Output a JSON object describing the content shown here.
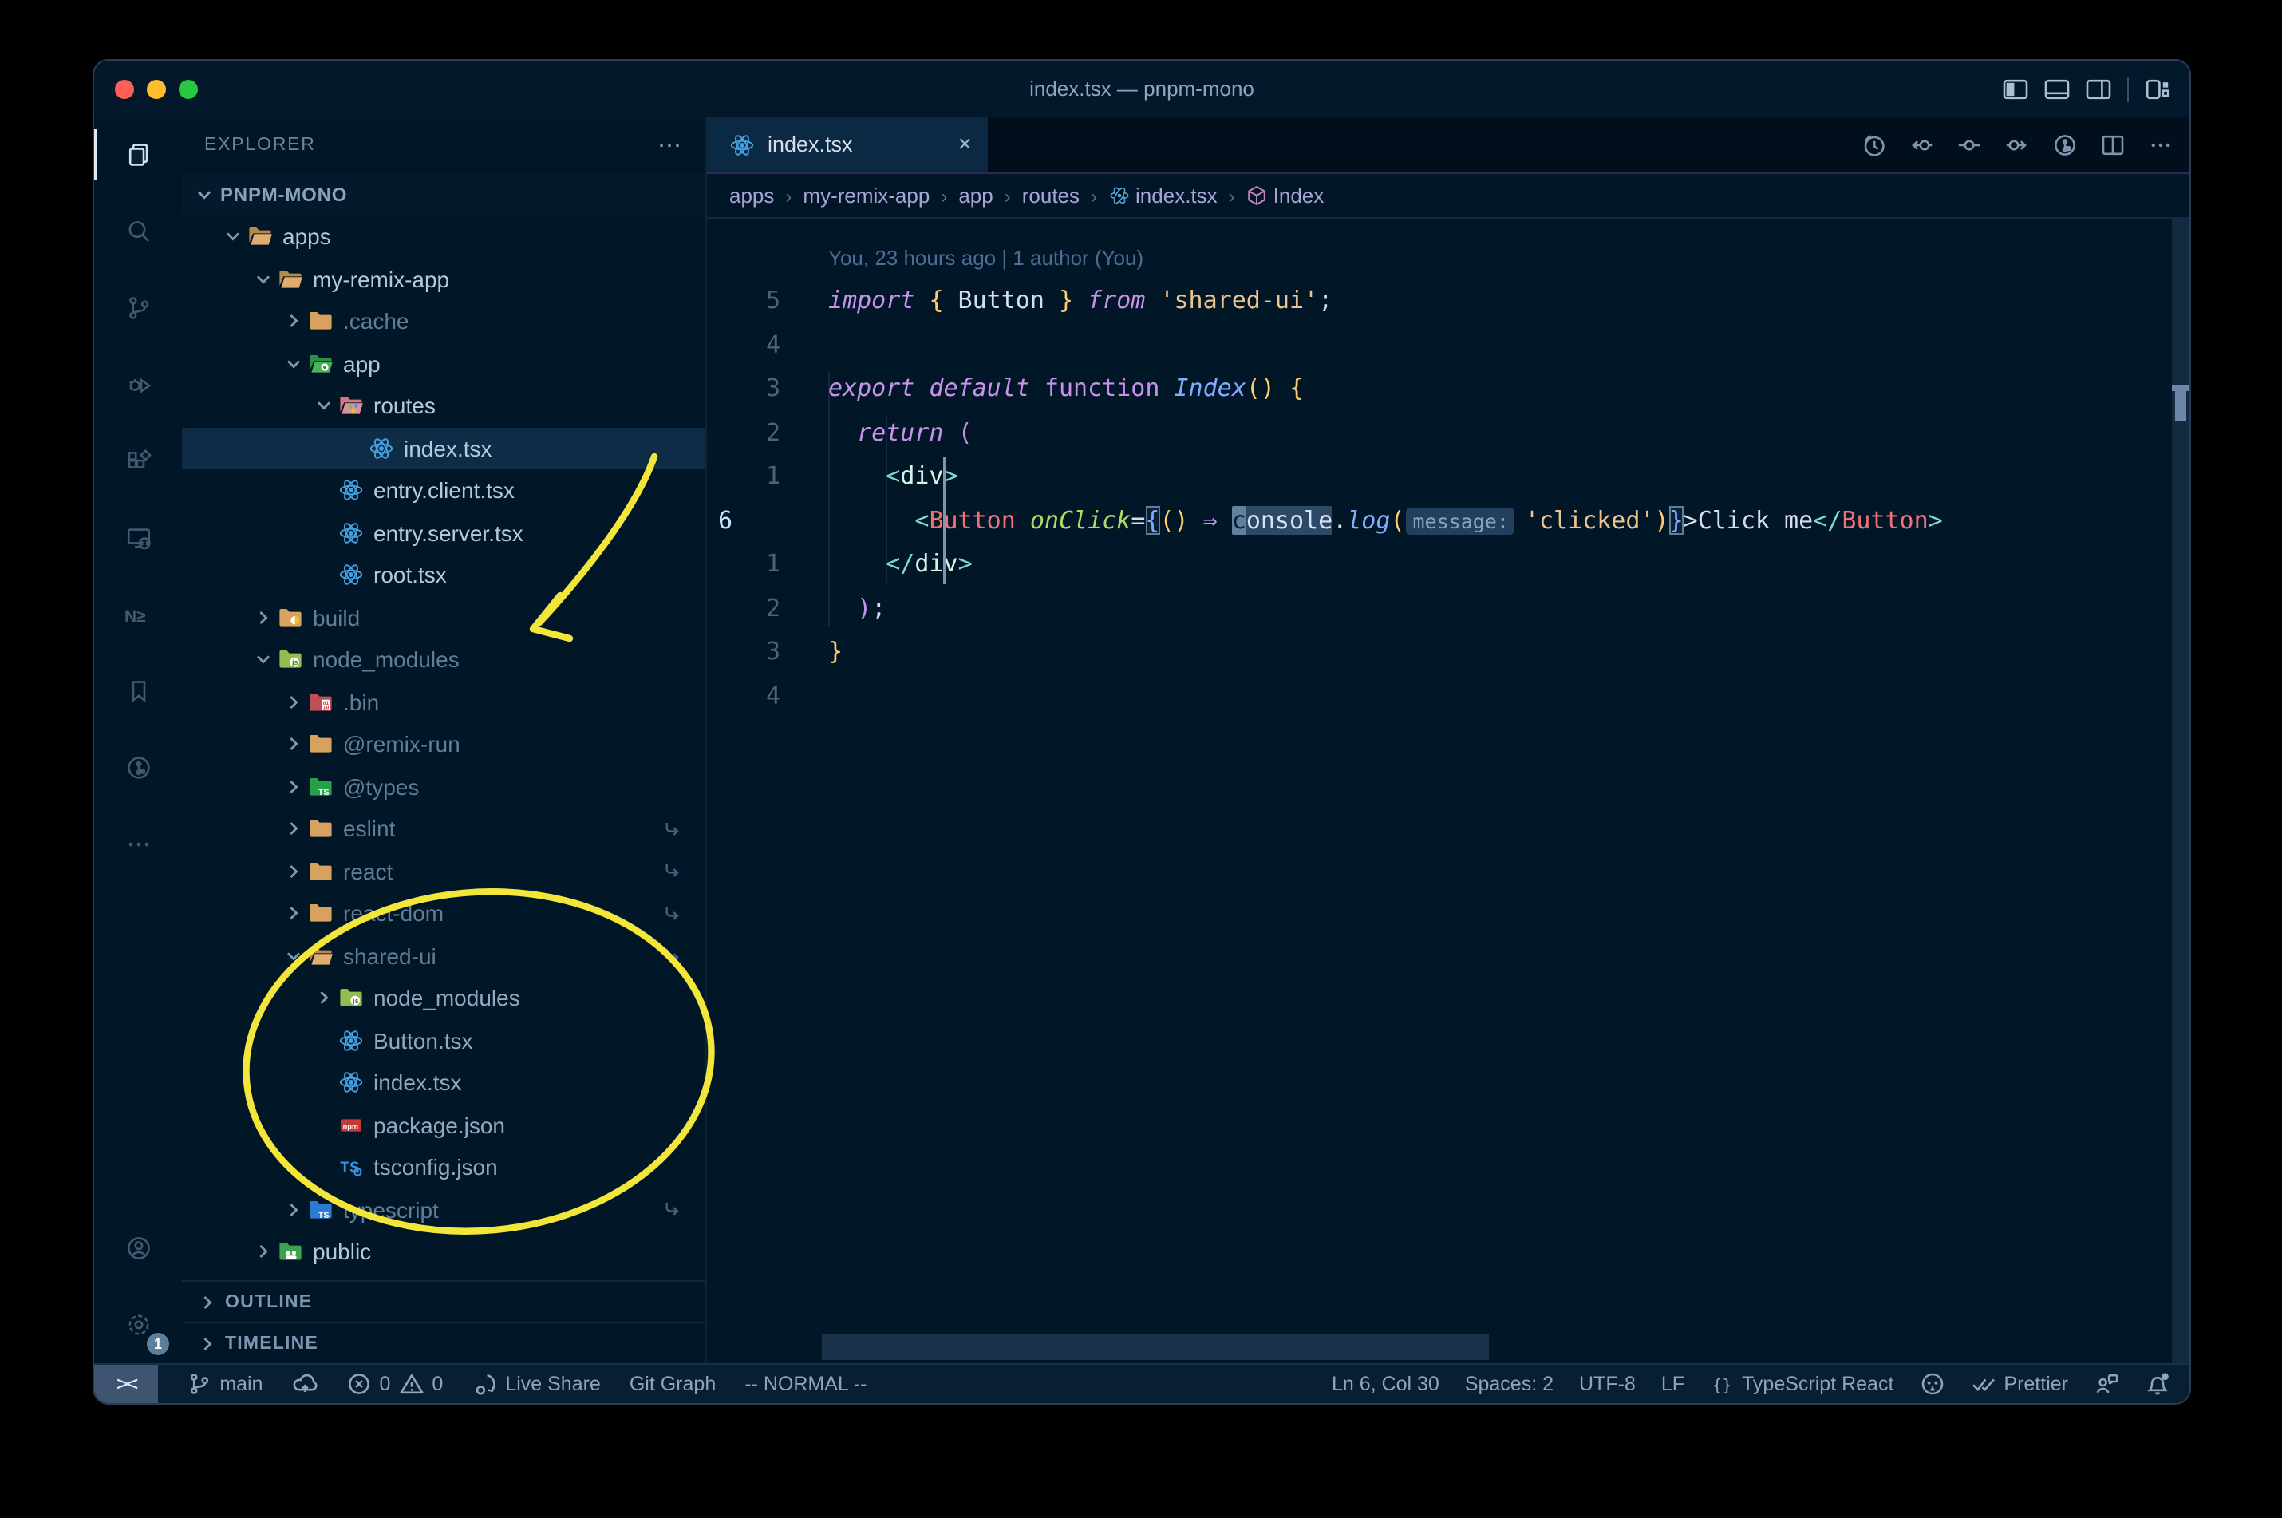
{
  "window": {
    "title": "index.tsx — pnpm-mono"
  },
  "title_bar": {
    "traffic_lights": [
      "close",
      "minimize",
      "zoom"
    ],
    "layout_icons": [
      "toggle-primary-sidebar",
      "toggle-panel",
      "toggle-secondary-sidebar",
      "customize-layout"
    ]
  },
  "activity_bar": {
    "top": [
      {
        "name": "explorer",
        "icon": "files",
        "active": true
      },
      {
        "name": "search",
        "icon": "search",
        "active": false
      },
      {
        "name": "source-control",
        "icon": "git-branch-big",
        "active": false
      },
      {
        "name": "run-debug",
        "icon": "debug",
        "active": false
      },
      {
        "name": "extensions",
        "icon": "extensions",
        "active": false
      },
      {
        "name": "remote-explorer",
        "icon": "remote",
        "active": false
      },
      {
        "name": "nx-console",
        "icon": "nx",
        "active": false
      },
      {
        "name": "bookmarks",
        "icon": "bookmark",
        "active": false
      },
      {
        "name": "gitlens",
        "icon": "gitlens",
        "active": false
      },
      {
        "name": "more-views",
        "icon": "moreh",
        "active": false
      }
    ],
    "bottom": [
      {
        "name": "accounts",
        "icon": "account",
        "active": false
      },
      {
        "name": "settings",
        "icon": "gear",
        "active": false,
        "badge": "1"
      }
    ]
  },
  "explorer": {
    "header": "EXPLORER",
    "more": "⋯",
    "root": "PNPM-MONO",
    "items": [
      {
        "label": "apps",
        "level": 1,
        "icon": "folder-tan-open",
        "chevron": "open",
        "tone": "bright"
      },
      {
        "label": "my-remix-app",
        "level": 2,
        "icon": "folder-tan-open",
        "chevron": "open",
        "tone": "bright"
      },
      {
        "label": ".cache",
        "level": 3,
        "icon": "folder-tan",
        "chevron": "closed",
        "tone": "dim"
      },
      {
        "label": "app",
        "level": 3,
        "icon": "folder-app",
        "chevron": "open",
        "tone": "bright"
      },
      {
        "label": "routes",
        "level": 4,
        "icon": "folder-routes",
        "chevron": "open",
        "tone": "bright"
      },
      {
        "label": "index.tsx",
        "level": 5,
        "icon": "react",
        "chevron": null,
        "tone": "bright",
        "selected": true
      },
      {
        "label": "entry.client.tsx",
        "level": 4,
        "icon": "react",
        "chevron": null,
        "tone": "bright"
      },
      {
        "label": "entry.server.tsx",
        "level": 4,
        "icon": "react",
        "chevron": null,
        "tone": "bright"
      },
      {
        "label": "root.tsx",
        "level": 4,
        "icon": "react",
        "chevron": null,
        "tone": "bright"
      },
      {
        "label": "build",
        "level": 2,
        "icon": "folder-build",
        "chevron": "closed",
        "tone": "dim"
      },
      {
        "label": "node_modules",
        "level": 2,
        "icon": "folder-nm",
        "chevron": "open",
        "tone": "dim"
      },
      {
        "label": ".bin",
        "level": 3,
        "icon": "folder-bin",
        "chevron": "closed",
        "tone": "dim"
      },
      {
        "label": "@remix-run",
        "level": 3,
        "icon": "folder-tan",
        "chevron": "closed",
        "tone": "dim"
      },
      {
        "label": "@types",
        "level": 3,
        "icon": "folder-types",
        "chevron": "closed",
        "tone": "dim"
      },
      {
        "label": "eslint",
        "level": 3,
        "icon": "folder-tan",
        "chevron": "closed",
        "tone": "dim",
        "symlink": true
      },
      {
        "label": "react",
        "level": 3,
        "icon": "folder-tan",
        "chevron": "closed",
        "tone": "dim",
        "symlink": true
      },
      {
        "label": "react-dom",
        "level": 3,
        "icon": "folder-tan",
        "chevron": "closed",
        "tone": "dim",
        "symlink": true
      },
      {
        "label": "shared-ui",
        "level": 3,
        "icon": "folder-tan-open",
        "chevron": "open",
        "tone": "dim",
        "symlink": true
      },
      {
        "label": "node_modules",
        "level": 4,
        "icon": "folder-nm",
        "chevron": "closed",
        "tone": "mid"
      },
      {
        "label": "Button.tsx",
        "level": 4,
        "icon": "react",
        "chevron": null,
        "tone": "mid"
      },
      {
        "label": "index.tsx",
        "level": 4,
        "icon": "react",
        "chevron": null,
        "tone": "mid"
      },
      {
        "label": "package.json",
        "level": 4,
        "icon": "npm",
        "chevron": null,
        "tone": "mid"
      },
      {
        "label": "tsconfig.json",
        "level": 4,
        "icon": "tsconfig",
        "chevron": null,
        "tone": "mid"
      },
      {
        "label": "typescript",
        "level": 3,
        "icon": "folder-ts-blue",
        "chevron": "closed",
        "tone": "dim",
        "symlink": true
      },
      {
        "label": "public",
        "level": 2,
        "icon": "folder-public",
        "chevron": "closed",
        "tone": "bright"
      }
    ],
    "sections": [
      {
        "label": "OUTLINE"
      },
      {
        "label": "TIMELINE"
      }
    ]
  },
  "tab": {
    "label": "index.tsx",
    "icon": "react",
    "close": "×"
  },
  "editor_actions": [
    "history",
    "prev-change",
    "compare",
    "next-change",
    "gitlens-graph",
    "split-editor",
    "more-actions"
  ],
  "breadcrumbs": {
    "items": [
      {
        "label": "apps"
      },
      {
        "label": "my-remix-app"
      },
      {
        "label": "app"
      },
      {
        "label": "routes"
      },
      {
        "label": "index.tsx",
        "icon": "react-small"
      },
      {
        "label": "Index",
        "icon": "symbol-module"
      }
    ]
  },
  "editor": {
    "blame": "You, 23 hours ago | 1 author (You)",
    "lines": [
      {
        "num": "5",
        "tokens": [
          [
            "k",
            "import"
          ],
          [
            "p",
            " "
          ],
          [
            "b",
            "{"
          ],
          [
            "p",
            " Button "
          ],
          [
            "b",
            "}"
          ],
          [
            "p",
            " "
          ],
          [
            "k",
            "from"
          ],
          [
            "p",
            " "
          ],
          [
            "str",
            "'shared-ui'"
          ],
          [
            "p",
            ";"
          ]
        ]
      },
      {
        "num": "4",
        "tokens": []
      },
      {
        "num": "3",
        "tokens": [
          [
            "k",
            "export"
          ],
          [
            "p",
            " "
          ],
          [
            "k",
            "default"
          ],
          [
            "p",
            " "
          ],
          [
            "kf",
            "function"
          ],
          [
            "p",
            " "
          ],
          [
            "fn",
            "Index"
          ],
          [
            "b",
            "()"
          ],
          [
            "p",
            " "
          ],
          [
            "b",
            "{"
          ]
        ]
      },
      {
        "num": "2",
        "tokens": [
          [
            "p",
            "  "
          ],
          [
            "k",
            "return"
          ],
          [
            "p",
            " "
          ],
          [
            "ar",
            "("
          ]
        ]
      },
      {
        "num": "1",
        "tokens": [
          [
            "p",
            "    "
          ],
          [
            "tp",
            "<"
          ],
          [
            "tag",
            "div"
          ],
          [
            "tp",
            ">"
          ]
        ]
      },
      {
        "num": "6",
        "current": true,
        "tokens": [
          [
            "p",
            "      "
          ],
          [
            "tp",
            "<"
          ],
          [
            "comp",
            "Button"
          ],
          [
            "p",
            " "
          ],
          [
            "attr",
            "onClick"
          ],
          [
            "p",
            "="
          ],
          [
            "bm",
            "{"
          ],
          [
            "b",
            "()"
          ],
          [
            "p",
            " "
          ],
          [
            "ar",
            "⇒"
          ],
          [
            "p",
            " "
          ],
          [
            "cur",
            "c"
          ],
          [
            "whl",
            "onsole"
          ],
          [
            "p",
            "."
          ],
          [
            "fn",
            "log"
          ],
          [
            "b",
            "("
          ],
          [
            "inlay",
            "message:"
          ],
          [
            "str",
            "'clicked'"
          ],
          [
            "b",
            ")"
          ],
          [
            "bm",
            "}"
          ],
          [
            "p",
            ">"
          ],
          [
            "p",
            "Click me"
          ],
          [
            "tp",
            "</"
          ],
          [
            "comp",
            "Button"
          ],
          [
            "tp",
            ">"
          ]
        ]
      },
      {
        "num": "1",
        "tokens": [
          [
            "p",
            "    "
          ],
          [
            "tp",
            "</"
          ],
          [
            "tag",
            "div"
          ],
          [
            "tp",
            ">"
          ]
        ]
      },
      {
        "num": "2",
        "tokens": [
          [
            "p",
            "  "
          ],
          [
            "ar",
            ")"
          ],
          [
            "p",
            ";"
          ]
        ]
      },
      {
        "num": "3",
        "tokens": [
          [
            "b",
            "}"
          ]
        ]
      },
      {
        "num": "4",
        "tokens": []
      }
    ]
  },
  "status_bar": {
    "left": [
      {
        "name": "remote-indicator",
        "kind": "remote",
        "label": "><"
      },
      {
        "name": "git-branch",
        "icon": "branch",
        "label": "main"
      },
      {
        "name": "sync",
        "icon": "cloud"
      },
      {
        "name": "problems",
        "icon": "error",
        "label": "0",
        "icon2": "warning",
        "label2": "0"
      },
      {
        "name": "live-share",
        "icon": "share",
        "label": "Live Share"
      },
      {
        "name": "git-graph",
        "label": "Git Graph"
      },
      {
        "name": "vim-mode",
        "label": "-- NORMAL --"
      }
    ],
    "right": [
      {
        "name": "cursor-position",
        "label": "Ln 6, Col 30"
      },
      {
        "name": "indentation",
        "label": "Spaces: 2"
      },
      {
        "name": "encoding",
        "label": "UTF-8"
      },
      {
        "name": "eol",
        "label": "LF"
      },
      {
        "name": "language-mode",
        "icon": "braces",
        "label": "TypeScript React"
      },
      {
        "name": "github",
        "icon": "octo"
      },
      {
        "name": "prettier",
        "icon": "dblcheck",
        "label": "Prettier"
      },
      {
        "name": "feedback",
        "icon": "feedback"
      },
      {
        "name": "notifications",
        "icon": "bell"
      }
    ]
  },
  "annotations": {
    "color": "#f2e63a",
    "shapes": [
      "arrow-to-node-modules",
      "ellipse-around-shared-ui"
    ]
  }
}
